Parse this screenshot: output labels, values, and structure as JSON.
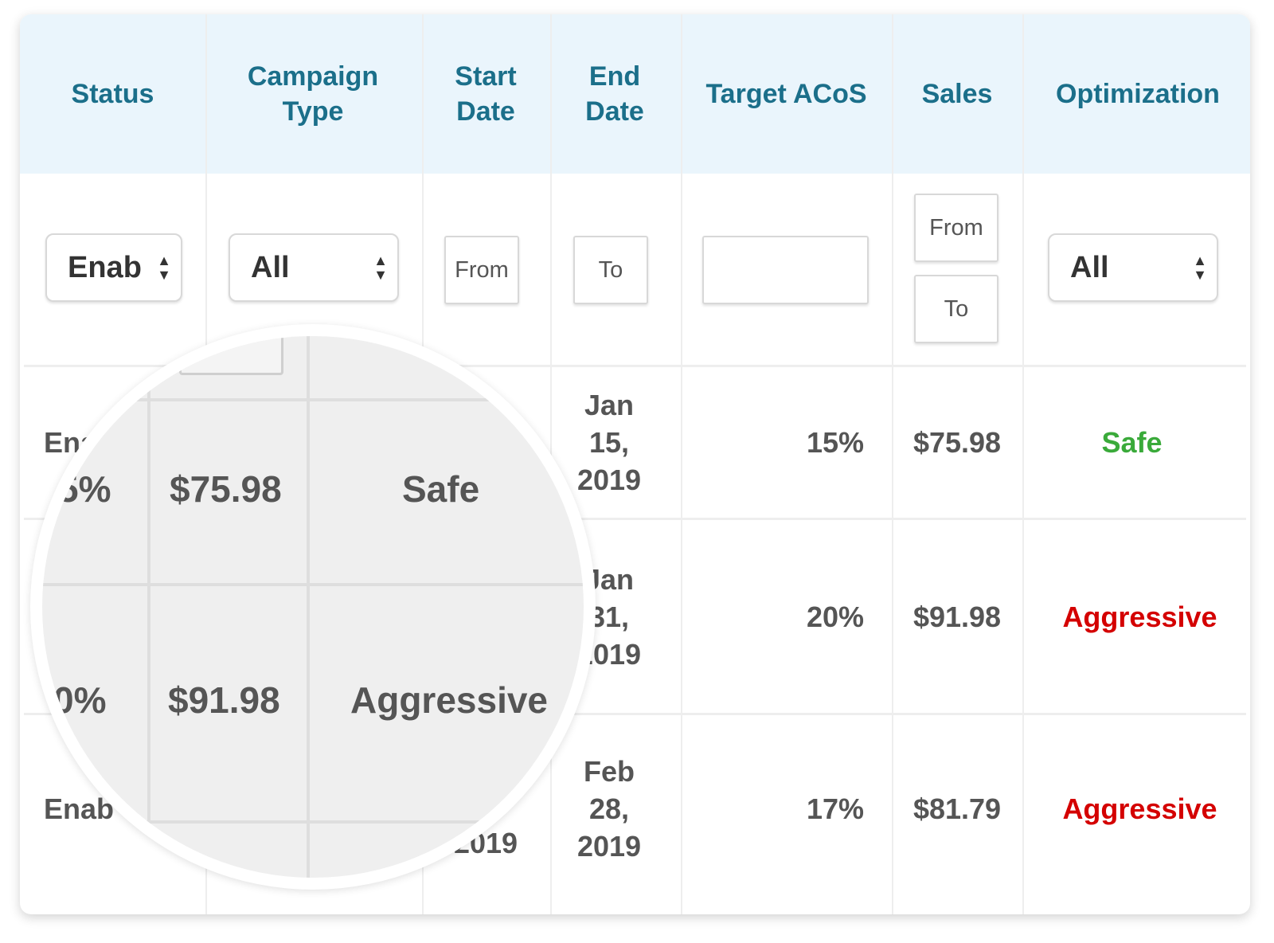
{
  "headers": {
    "status": "Status",
    "campaign_type": "Campaign Type",
    "start_date": "Start Date",
    "end_date": "End Date",
    "target_acos": "Target ACoS",
    "sales": "Sales",
    "optimization": "Optimization"
  },
  "filters": {
    "status_value": "Enab",
    "campaign_type_value": "All",
    "start_date_placeholder": "From",
    "end_date_placeholder": "To",
    "target_acos_value": "",
    "sales_from_placeholder": "From",
    "sales_to_placeholder": "To",
    "optimization_value": "All"
  },
  "rows": [
    {
      "status": "Ena",
      "end_date": "Jan 15, 2019",
      "target_acos": "15%",
      "sales": "$75.98",
      "optimization": "Safe"
    },
    {
      "status": "",
      "end_date": "Jan 31, 2019",
      "target_acos": "20%",
      "sales": "$91.98",
      "optimization": "Aggressive"
    },
    {
      "status": "Enab",
      "start_date": "2019",
      "end_date": "Feb 28, 2019",
      "target_acos": "17%",
      "sales": "$81.79",
      "optimization": "Aggressive"
    }
  ],
  "magnifier": {
    "rows": [
      {
        "target_acos": "5%",
        "sales": "$75.98",
        "optimization": "Safe"
      },
      {
        "target_acos": "0%",
        "sales": "$91.98",
        "optimization": "Aggressive"
      }
    ]
  },
  "colors": {
    "header_bg": "#eaf5fc",
    "header_text": "#1b6f8a",
    "safe": "#3aaa3a",
    "aggressive": "#d40000"
  }
}
